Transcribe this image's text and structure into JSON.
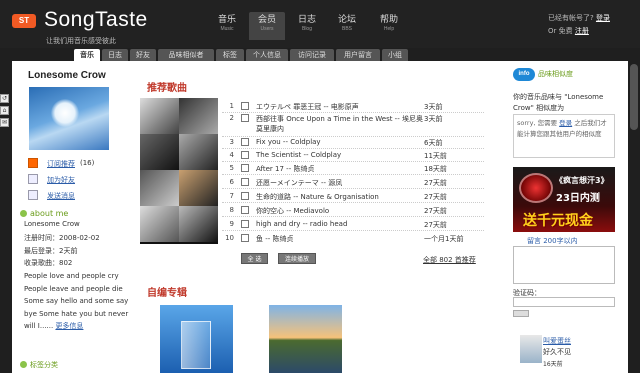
{
  "header": {
    "logo_badge": "ST",
    "logo_text": "SongTaste",
    "tagline": "让我们用音乐感受彼此",
    "nav": [
      {
        "zh": "音乐",
        "en": "Music"
      },
      {
        "zh": "会员",
        "en": "Users"
      },
      {
        "zh": "日志",
        "en": "Blog"
      },
      {
        "zh": "论坛",
        "en": "BBS"
      },
      {
        "zh": "帮助",
        "en": "Help"
      }
    ],
    "account_prefix": "已经有帐号了?",
    "login": "登录",
    "register_prefix": "Or 免费",
    "register": "注册"
  },
  "subtabs": [
    "音乐",
    "日志",
    "好友",
    "品味相似者",
    "标签",
    "个人信息",
    "访问记录",
    "用户留言",
    "小组"
  ],
  "profile": {
    "name": "Lonesome Crow",
    "actions": [
      {
        "label": "订阅推荐",
        "count": "(16)",
        "icon": "rss-icon"
      },
      {
        "label": "加为好友",
        "icon": "add-friend-icon"
      },
      {
        "label": "发送消息",
        "icon": "message-icon"
      }
    ],
    "about_title": "about me",
    "about_name": "Lonesome Crow",
    "register_time": "注册时间：2008-02-02",
    "last_login": "最后登录：2天前",
    "songs_count": "收录歌曲：802",
    "bio": "People love and people cry People leave and people die Some say hello and some say bye Some hate you but never will I......",
    "bio_more": "更多信息",
    "tag_category": "标签分类"
  },
  "edge_tools": [
    "↺",
    "⌂",
    "✉"
  ],
  "recommended": {
    "title": "推荐歌曲",
    "songs": [
      {
        "num": "1",
        "title": "エウテルペ 罪恶王冠 -- 电影原声",
        "time": "3天前"
      },
      {
        "num": "2",
        "title": "西部往事 Once Upon a Time in the West -- 埃尼奥 莫里康内",
        "time": "3天前"
      },
      {
        "num": "3",
        "title": "Fix you -- Coldplay",
        "time": "6天前"
      },
      {
        "num": "4",
        "title": "The Scientist -- Coldplay",
        "time": "11天前"
      },
      {
        "num": "5",
        "title": "After 17 -- 陈绮贞",
        "time": "18天前"
      },
      {
        "num": "6",
        "title": "还愿ーメインテーマ -- 源凤",
        "time": "27天前"
      },
      {
        "num": "7",
        "title": "生命的道路 -- Nature & Organisation",
        "time": "27天前"
      },
      {
        "num": "8",
        "title": "你的空心 -- Mediavolo",
        "time": "27天前"
      },
      {
        "num": "9",
        "title": "high and dry -- radio head",
        "time": "27天前"
      },
      {
        "num": "10",
        "title": "鱼 -- 陈绮贞",
        "time": "一个月1天前"
      }
    ],
    "select_all": "全 选",
    "play_continuous": "连续播放",
    "all_songs": "全部 802 首推荐"
  },
  "albums": {
    "title": "自编专辑"
  },
  "taste": {
    "badge": "info",
    "title": "品味相似度",
    "desc": "你的音乐品味与 \"Lonesome Crow\" 相似度为",
    "box_prefix": "sorry, 您需要",
    "box_login": "登录",
    "box_suffix": "之后我们才能计算您跟其他用户的相似度"
  },
  "ad": {
    "line1": "《疯言想汗3》",
    "line2": "23日内测",
    "line3": "送千元现金"
  },
  "message": {
    "label": "留言 200字以内",
    "verify": "验证码："
  },
  "visitor": {
    "name": "叫爱蛋丝",
    "status": "好久不见",
    "time": "16天前"
  }
}
